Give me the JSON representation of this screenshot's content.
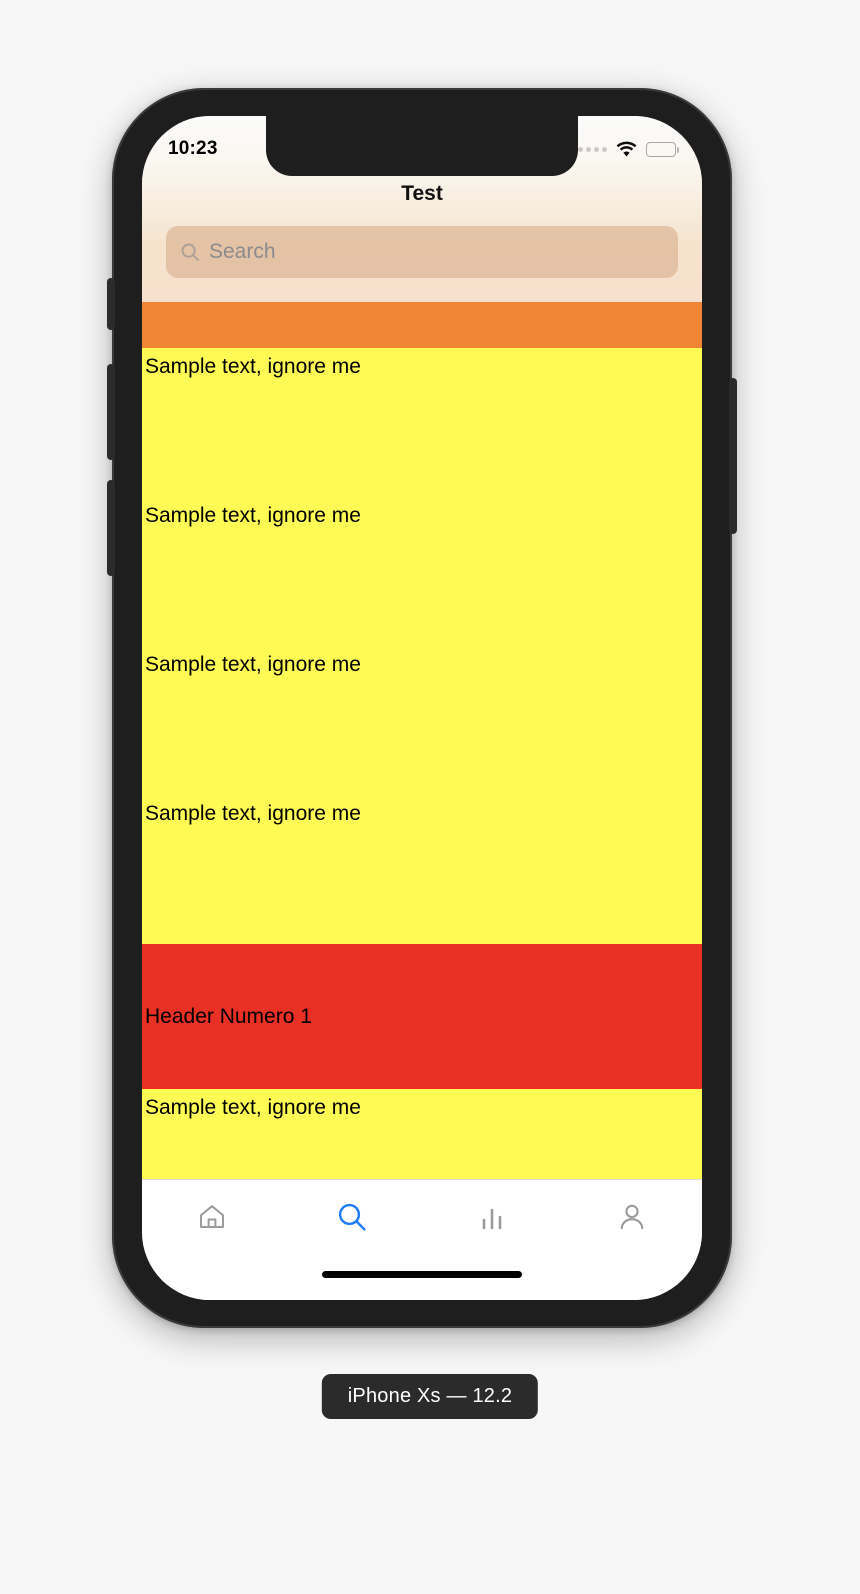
{
  "device": {
    "label": "iPhone Xs — 12.2"
  },
  "status_bar": {
    "time": "10:23",
    "cellular_icon": "signal-dots-icon",
    "wifi_icon": "wifi-icon",
    "battery_icon": "battery-full-icon"
  },
  "nav": {
    "title": "Test"
  },
  "search": {
    "icon": "search-icon",
    "placeholder": "Search",
    "value": ""
  },
  "colors": {
    "orange_band": "#F08533",
    "yellow_row": "#FFFB54",
    "red_header": "#E83024",
    "tab_active": "#1E7BF5",
    "tab_inactive": "#9b9b9b",
    "search_field": "#CE9E75"
  },
  "content": {
    "band": {
      "label": ""
    },
    "rows": [
      {
        "text": "Sample text, ignore me"
      },
      {
        "text": "Sample text, ignore me"
      },
      {
        "text": "Sample text, ignore me"
      },
      {
        "text": "Sample text, ignore me"
      }
    ],
    "section_header": {
      "text": "Header Numero 1"
    },
    "rows_after": [
      {
        "text": "Sample text, ignore me"
      }
    ]
  },
  "tabbar": {
    "items": [
      {
        "name": "home",
        "icon": "home-icon",
        "active": false
      },
      {
        "name": "search",
        "icon": "search-icon",
        "active": true
      },
      {
        "name": "stats",
        "icon": "bar-chart-icon",
        "active": false
      },
      {
        "name": "profile",
        "icon": "person-icon",
        "active": false
      }
    ]
  }
}
